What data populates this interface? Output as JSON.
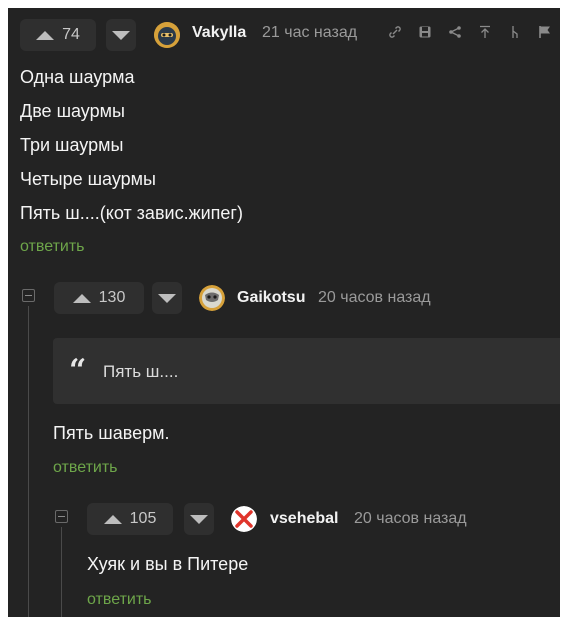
{
  "comments": [
    {
      "votes": "74",
      "username": "Vakylla",
      "time": "21 час назад",
      "lines": [
        "Одна шаурма",
        "Две шаурмы",
        "Три шаурмы",
        "Четыре шаурмы",
        "Пять ш....(кот завис.жипег)"
      ],
      "reply_label": "ответить"
    },
    {
      "votes": "130",
      "username": "Gaikotsu",
      "time": "20 часов назад",
      "quote": "Пять ш....",
      "lines": [
        "Пять шаверм."
      ],
      "reply_label": "ответить"
    },
    {
      "votes": "105",
      "username": "vsehebal",
      "time": "20 часов назад",
      "lines": [
        "Хуяк и вы в Питере"
      ],
      "reply_label": "ответить"
    }
  ],
  "toolbar_icons": [
    "link-icon",
    "save-icon",
    "share-icon",
    "scroll-top-icon",
    "branch-icon",
    "flag-icon"
  ],
  "colors": {
    "background": "#232323",
    "reply_link": "#6ea64a",
    "text": "#f4f4f4",
    "meta": "#9a9a9a"
  }
}
